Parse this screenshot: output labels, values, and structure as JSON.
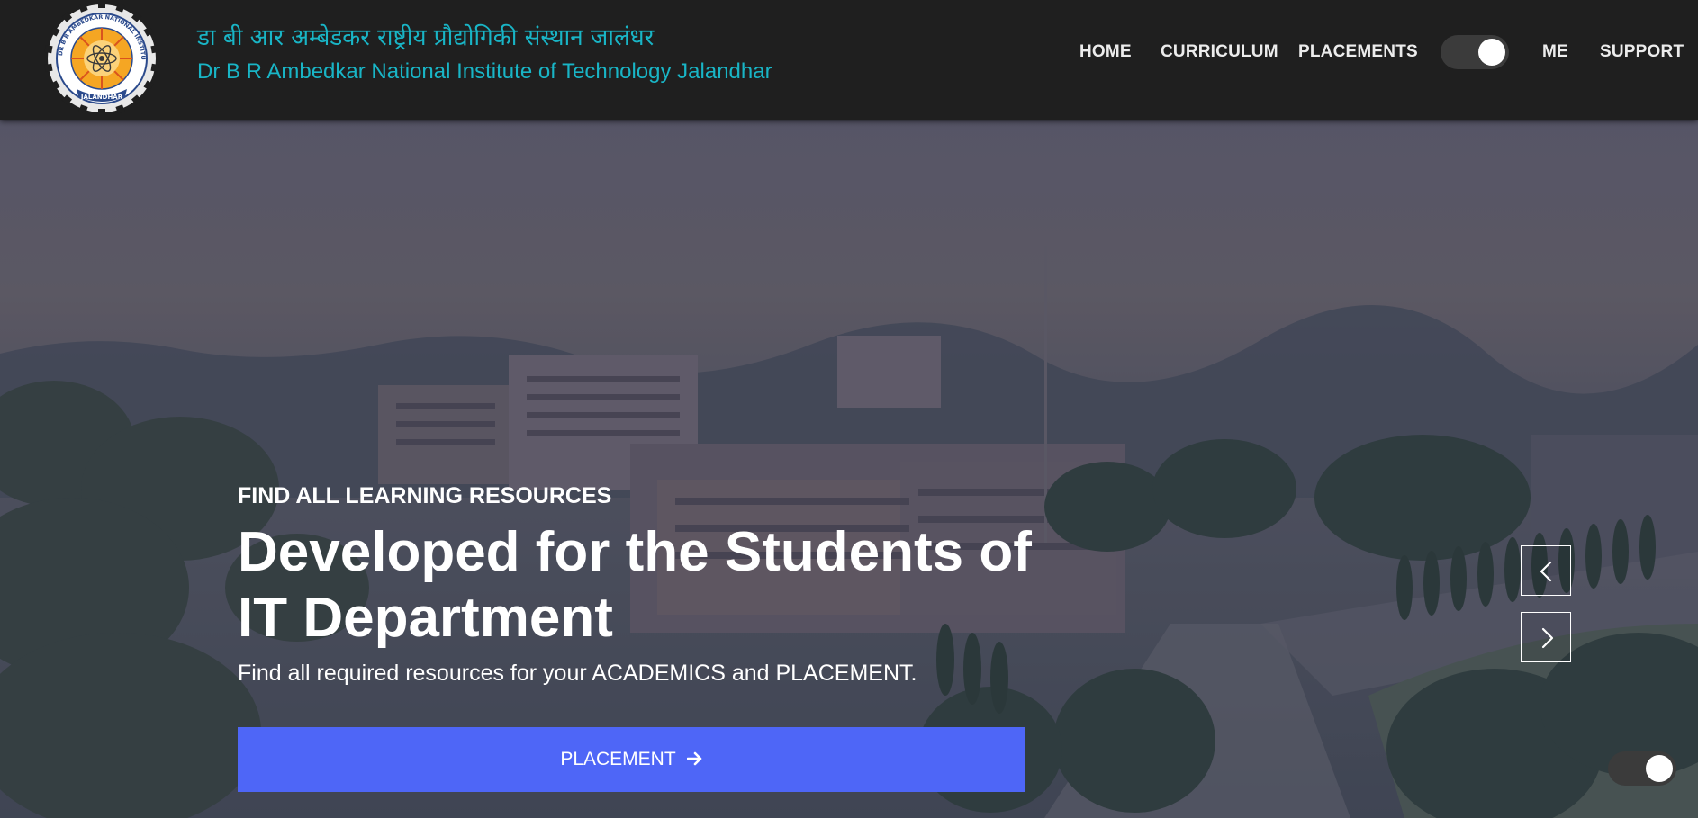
{
  "header": {
    "institute_name_hindi": "डा बी आर अम्बेडकर राष्ट्रीय प्रौद्योगिकी संस्थान जालंधर",
    "institute_name_english": "Dr B R Ambedkar National Institute of Technology Jalandhar",
    "logo_icon": "nit-jalandhar-emblem-icon",
    "logo_text": {
      "ring": "DR B R AMBEDKAR NATIONAL INSTITUTE OF TECHNOLOGY",
      "bottom": "JALANDHAR"
    },
    "nav": {
      "home": "HOME",
      "curriculum": "CURRICULUM",
      "placements": "PLACEMENTS",
      "me": "ME",
      "support": "SUPPORT"
    },
    "theme_toggle": {
      "state": "on"
    }
  },
  "hero": {
    "eyebrow": "FIND ALL LEARNING RESOURCES",
    "headline": "Developed for the Students of IT Department",
    "subline": "Find all required resources for your ACADEMICS and PLACEMENT.",
    "cta_label": "PLACEMENT",
    "cta_icon": "arrow-right-icon",
    "prev_icon": "chevron-left-icon",
    "next_icon": "chevron-right-icon",
    "floating_toggle": {
      "state": "on"
    }
  },
  "colors": {
    "header_bg": "#1f1f1f",
    "brand_teal": "#19b5c6",
    "cta_blue": "#4e66f7",
    "nav_text": "#ececec"
  }
}
